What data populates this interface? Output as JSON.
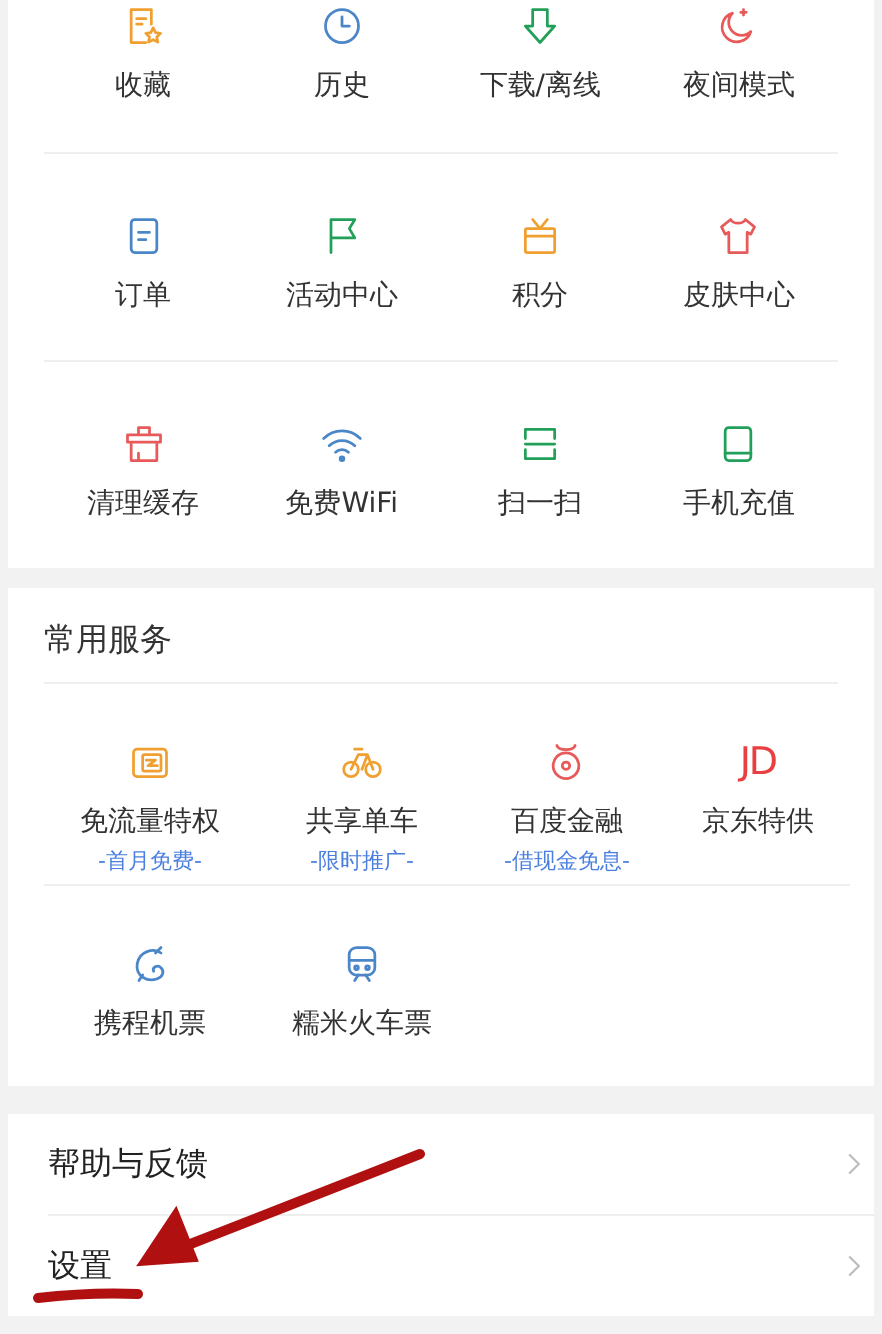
{
  "tools": [
    {
      "label": "收藏"
    },
    {
      "label": "历史"
    },
    {
      "label": "下载/离线"
    },
    {
      "label": "夜间模式"
    },
    {
      "label": "订单"
    },
    {
      "label": "活动中心"
    },
    {
      "label": "积分"
    },
    {
      "label": "皮肤中心"
    },
    {
      "label": "清理缓存"
    },
    {
      "label": "免费WiFi"
    },
    {
      "label": "扫一扫"
    },
    {
      "label": "手机充值"
    }
  ],
  "services": {
    "title": "常用服务",
    "items": [
      {
        "label": "免流量特权",
        "note": "-首月免费-"
      },
      {
        "label": "共享单车",
        "note": "-限时推广-"
      },
      {
        "label": "百度金融",
        "note": "-借现金免息-"
      },
      {
        "label": "京东特供",
        "icon_text": "JD"
      },
      {
        "label": "携程机票"
      },
      {
        "label": "糯米火车票"
      }
    ]
  },
  "menu": [
    {
      "label": "帮助与反馈"
    },
    {
      "label": "设置"
    }
  ],
  "annotation": {
    "kind": "arrow-underline"
  }
}
